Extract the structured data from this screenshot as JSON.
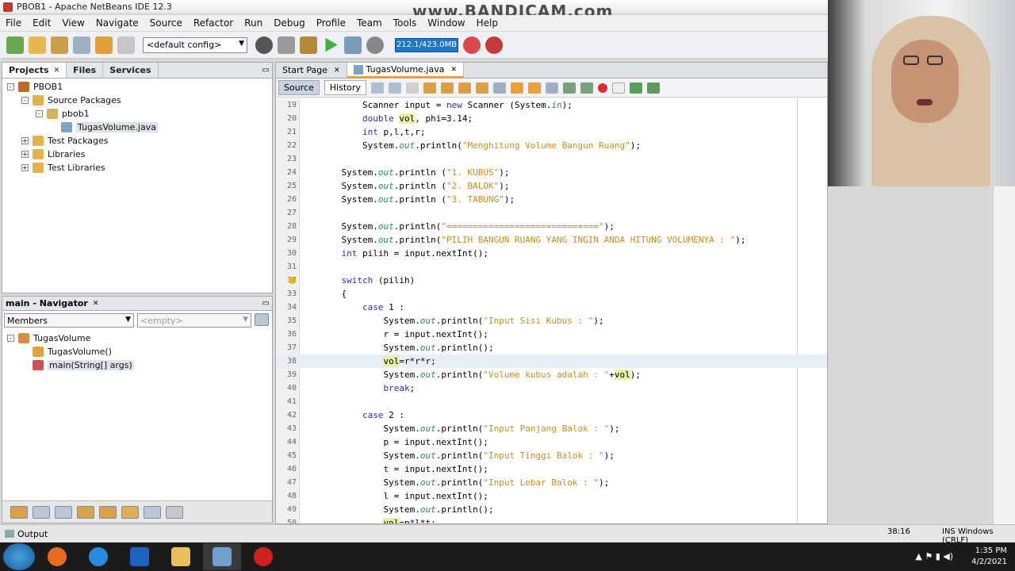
{
  "window": {
    "title": "PBOB1 - Apache NetBeans IDE 12.3",
    "watermark": "www.BANDICAM.com"
  },
  "menu": [
    "File",
    "Edit",
    "View",
    "Navigate",
    "Source",
    "Refactor",
    "Run",
    "Debug",
    "Profile",
    "Team",
    "Tools",
    "Window",
    "Help"
  ],
  "toolbar": {
    "config": "<default config>",
    "memory": "212.1/423.0MB"
  },
  "projects": {
    "tabs": [
      "Projects",
      "Files",
      "Services"
    ],
    "tree": [
      {
        "label": "PBOB1",
        "indent": 0,
        "tog": "-",
        "icon": "#c0692a"
      },
      {
        "label": "Source Packages",
        "indent": 1,
        "tog": "-",
        "icon": "#e3b24a"
      },
      {
        "label": "pbob1",
        "indent": 2,
        "tog": "-",
        "icon": "#d9b060"
      },
      {
        "label": "TugasVolume.java",
        "indent": 3,
        "tog": "",
        "icon": "#7ea3c9",
        "selected": true
      },
      {
        "label": "Test Packages",
        "indent": 1,
        "tog": "+",
        "icon": "#e3b24a"
      },
      {
        "label": "Libraries",
        "indent": 1,
        "tog": "+",
        "icon": "#e3b24a"
      },
      {
        "label": "Test Libraries",
        "indent": 1,
        "tog": "+",
        "icon": "#e3b24a"
      }
    ]
  },
  "navigator": {
    "title": "main - Navigator",
    "filter": "Members",
    "empty": "<empty>",
    "tree": [
      {
        "label": "TugasVolume",
        "indent": 0,
        "tog": "-",
        "icon": "#d98b4a"
      },
      {
        "label": "TugasVolume()",
        "indent": 1,
        "tog": "",
        "icon": "#e0a33c"
      },
      {
        "label": "main(String[] args)",
        "indent": 1,
        "tog": "",
        "icon": "#d05050",
        "selected": true
      }
    ]
  },
  "editor": {
    "tabs": [
      "Start Page",
      "TugasVolume.java"
    ],
    "source_label": "Source",
    "history_label": "History",
    "lines": [
      {
        "n": "19",
        "html": "        Scanner input = <span class='kw'>new</span> Scanner (System.<span class='fld'>in</span>);"
      },
      {
        "n": "20",
        "html": "        <span class='kw'>double</span> <span class='hl'>vol</span>, phi=3.14;"
      },
      {
        "n": "21",
        "html": "        <span class='kw'>int</span> p,l,t,r;"
      },
      {
        "n": "22",
        "html": "        System.<span class='fld'>out</span>.println(<span class='str'>\"Menghitung Volume Bangun Ruang\"</span>);"
      },
      {
        "n": "23",
        "html": ""
      },
      {
        "n": "24",
        "html": "    System.<span class='fld'>out</span>.println (<span class='str'>\"1. KUBUS\"</span>);"
      },
      {
        "n": "25",
        "html": "    System.<span class='fld'>out</span>.println (<span class='str'>\"2. BALOK\"</span>);"
      },
      {
        "n": "26",
        "html": "    System.<span class='fld'>out</span>.println (<span class='str'>\"3. TABUNG\"</span>);"
      },
      {
        "n": "27",
        "html": ""
      },
      {
        "n": "28",
        "html": "    System.<span class='fld'>out</span>.println(<span class='str'>\"=============================\"</span>);"
      },
      {
        "n": "29",
        "html": "    System.<span class='fld'>out</span>.println(<span class='str'>\"PILIH BANGUN RUANG YANG INGIN ANDA HITUNG VOLUMENYA : \"</span>);"
      },
      {
        "n": "30",
        "html": "    <span class='kw'>int</span> pilih = input.nextInt();"
      },
      {
        "n": "31",
        "html": ""
      },
      {
        "n": "32",
        "html": "    <span class='kw'>switch</span> (pilih)",
        "bulb": true
      },
      {
        "n": "33",
        "html": "    {"
      },
      {
        "n": "34",
        "html": "        <span class='kw'>case</span> 1 :"
      },
      {
        "n": "35",
        "html": "            System.<span class='fld'>out</span>.println(<span class='str'>\"Input Sisi Kubus : \"</span>);"
      },
      {
        "n": "36",
        "html": "            r = input.nextInt();"
      },
      {
        "n": "37",
        "html": "            System.<span class='fld'>out</span>.println();"
      },
      {
        "n": "38",
        "html": "            <span class='hl'>vol</span>=r*r*r;",
        "cur": true
      },
      {
        "n": "39",
        "html": "            System.<span class='fld'>out</span>.println(<span class='str'>\"Volume kubus adalah : \"</span>+<span class='hl'>vol</span>);"
      },
      {
        "n": "40",
        "html": "            <span class='kw'>break</span>;"
      },
      {
        "n": "41",
        "html": ""
      },
      {
        "n": "42",
        "html": "        <span class='kw'>case</span> 2 :"
      },
      {
        "n": "43",
        "html": "            System.<span class='fld'>out</span>.println(<span class='str'>\"Input Panjang Balok : \"</span>);"
      },
      {
        "n": "44",
        "html": "            p = input.nextInt();"
      },
      {
        "n": "45",
        "html": "            System.<span class='fld'>out</span>.println(<span class='str'>\"Input Tinggi Balok : \"</span>);"
      },
      {
        "n": "46",
        "html": "            t = input.nextInt();"
      },
      {
        "n": "47",
        "html": "            System.<span class='fld'>out</span>.println(<span class='str'>\"Input Lebar Balok : \"</span>);"
      },
      {
        "n": "48",
        "html": "            l = input.nextInt();"
      },
      {
        "n": "49",
        "html": "            System.<span class='fld'>out</span>.println();"
      },
      {
        "n": "50",
        "html": "            <span class='hl'>vol</span>=p*l*t;"
      }
    ]
  },
  "status": {
    "output": "Output",
    "position": "38:16",
    "mode": "INS Windows (CRLF)"
  },
  "taskbar": {
    "time": "1:35 PM",
    "date": "4/2/2021"
  }
}
